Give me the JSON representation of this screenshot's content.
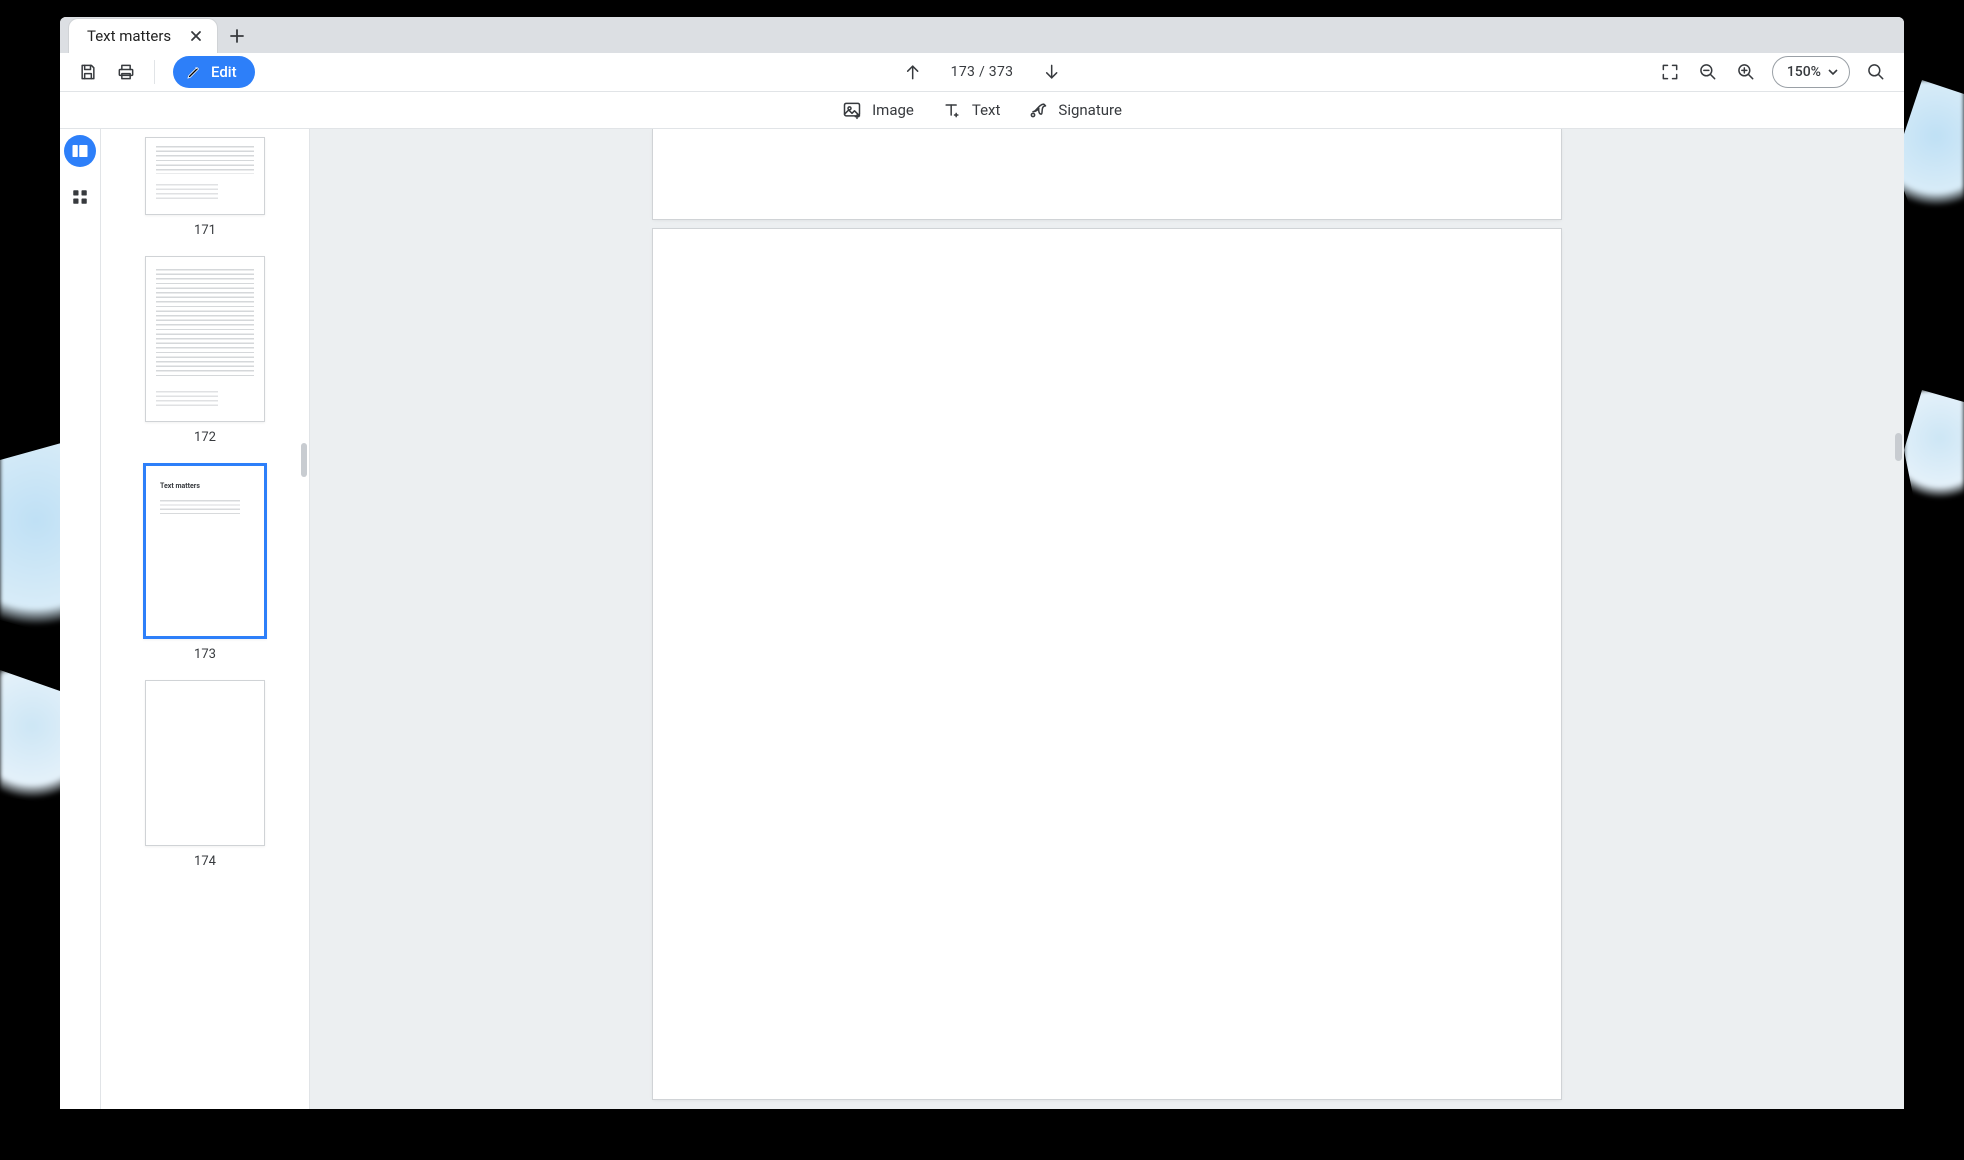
{
  "tabs": {
    "active_label": "Text matters"
  },
  "toolbar": {
    "edit_label": "Edit",
    "page_indicator": "173 / 373",
    "zoom_label": "150%"
  },
  "insertbar": {
    "image_label": "Image",
    "text_label": "Text",
    "signature_label": "Signature"
  },
  "thumbnails": {
    "p171_num": "171",
    "p172_num": "172",
    "p173_num": "173",
    "p174_num": "174",
    "p173_title": "Text matters"
  }
}
